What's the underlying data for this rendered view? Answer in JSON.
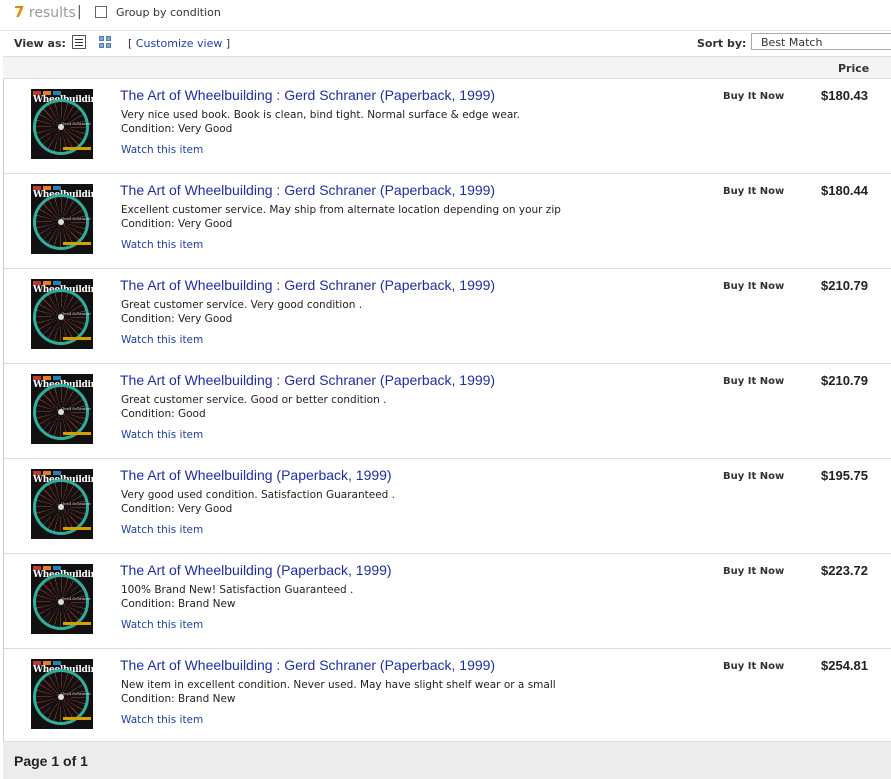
{
  "summary": {
    "count": "7",
    "count_suffix": "results",
    "separator": "|",
    "group_label": "Group by condition"
  },
  "view": {
    "label": "View as:",
    "customize": "Customize view",
    "bracket_open": "[",
    "bracket_close": "]",
    "sort_label": "Sort by:",
    "sort_value": "Best Match"
  },
  "table": {
    "price_header": "Price"
  },
  "thumbnail": {
    "cover_word": "Wheelbuilding",
    "cover_author": "Gerd Schraner"
  },
  "results": [
    {
      "title": "The Art of Wheelbuilding : Gerd Schraner (Paperback, 1999)",
      "description": "Very nice used book. Book is clean, bind tight. Normal surface & edge wear.",
      "condition": "Condition: Very Good",
      "watch": "Watch this item",
      "format": "Buy It Now",
      "price": "$180.43"
    },
    {
      "title": "The Art of Wheelbuilding : Gerd Schraner (Paperback, 1999)",
      "description": "Excellent customer service. May ship from alternate location depending on your zip",
      "condition": "Condition: Very Good",
      "watch": "Watch this item",
      "format": "Buy It Now",
      "price": "$180.44"
    },
    {
      "title": "The Art of Wheelbuilding : Gerd Schraner (Paperback, 1999)",
      "description": "Great customer service. Very good condition .",
      "condition": "Condition: Very Good",
      "watch": "Watch this item",
      "format": "Buy It Now",
      "price": "$210.79"
    },
    {
      "title": "The Art of Wheelbuilding : Gerd Schraner (Paperback, 1999)",
      "description": "Great customer service. Good or better condition .",
      "condition": "Condition: Good",
      "watch": "Watch this item",
      "format": "Buy It Now",
      "price": "$210.79"
    },
    {
      "title": "The Art of Wheelbuilding (Paperback, 1999)",
      "description": "Very good used condition. Satisfaction Guaranteed .",
      "condition": "Condition: Very Good",
      "watch": "Watch this item",
      "format": "Buy It Now",
      "price": "$195.75"
    },
    {
      "title": "The Art of Wheelbuilding (Paperback, 1999)",
      "description": "100% Brand New! Satisfaction Guaranteed .",
      "condition": "Condition: Brand New",
      "watch": "Watch this item",
      "format": "Buy It Now",
      "price": "$223.72"
    },
    {
      "title": "The Art of Wheelbuilding : Gerd Schraner (Paperback, 1999)",
      "description": "New item in excellent condition. Never used. May have slight shelf wear or a small",
      "condition": "Condition: Brand New",
      "watch": "Watch this item",
      "format": "Buy It Now",
      "price": "$254.81"
    }
  ],
  "pagination": {
    "label": "Page 1 of 1"
  },
  "colors": {
    "count_accent": "#e58a00",
    "link": "#1f2ea8",
    "cover_bars": [
      "#c0392b",
      "#e67e22",
      "#2980b9"
    ]
  }
}
